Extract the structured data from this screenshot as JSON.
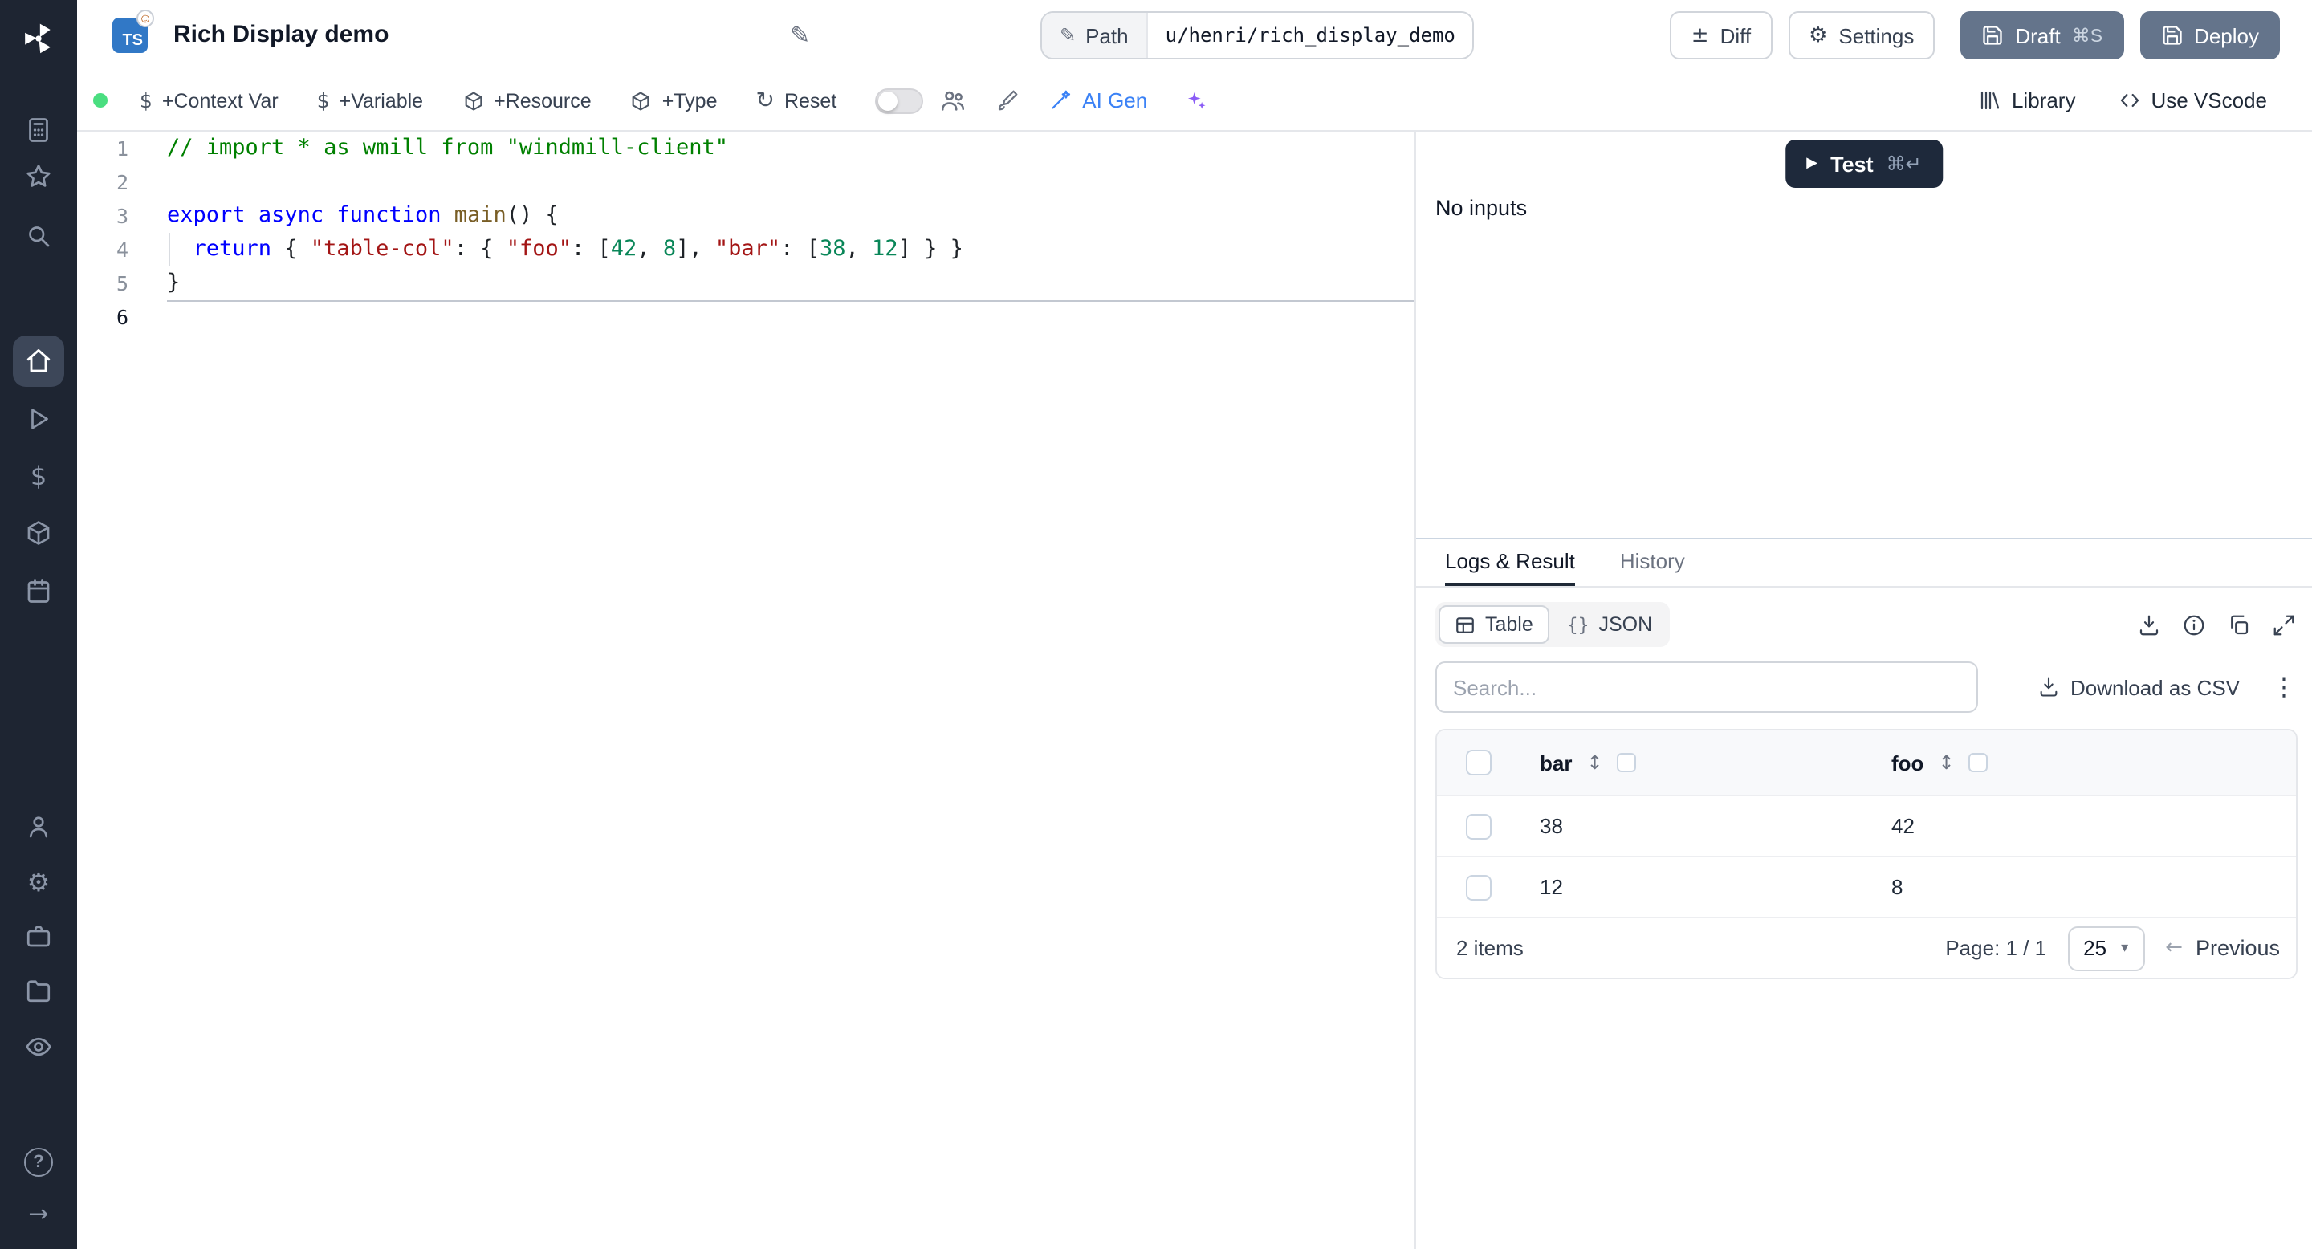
{
  "topbar": {
    "ts_badge": "TS",
    "sticker": "☺",
    "title": "Rich Display demo",
    "path_label": "Path",
    "path_value": "u/henri/rich_display_demo",
    "diff_label": "Diff",
    "settings_label": "Settings",
    "draft_label": "Draft",
    "draft_shortcut": "⌘S",
    "deploy_label": "Deploy"
  },
  "toolbar": {
    "context_var_label": "+Context Var",
    "variable_label": "+Variable",
    "resource_label": "+Resource",
    "type_label": "+Type",
    "reset_label": "Reset",
    "ai_gen_label": "AI Gen",
    "library_label": "Library",
    "vscode_label": "Use VScode"
  },
  "icons": {
    "pencil": "✎",
    "gear": "⚙",
    "reset": "↻",
    "diff": "±",
    "dollar": "$",
    "kebab": "⋮",
    "sort": "↕",
    "chevron_down": "▾",
    "arrow_left": "←",
    "arrow_right": "→",
    "play": "▶",
    "braces": "{}",
    "question": "?"
  },
  "editor": {
    "lines": [
      {
        "num": "1",
        "segments": [
          {
            "c": "comment",
            "t": "// import * as wmill from \"windmill-client\""
          }
        ]
      },
      {
        "num": "2",
        "segments": []
      },
      {
        "num": "3",
        "segments": [
          {
            "c": "keyword",
            "t": "export"
          },
          {
            "c": "plain",
            "t": " "
          },
          {
            "c": "keyword",
            "t": "async"
          },
          {
            "c": "plain",
            "t": " "
          },
          {
            "c": "keyword",
            "t": "function"
          },
          {
            "c": "plain",
            "t": " "
          },
          {
            "c": "func",
            "t": "main"
          },
          {
            "c": "plain",
            "t": "() {"
          }
        ]
      },
      {
        "num": "4",
        "guide": true,
        "segments": [
          {
            "c": "plain",
            "t": "  "
          },
          {
            "c": "keyword",
            "t": "return"
          },
          {
            "c": "plain",
            "t": " { "
          },
          {
            "c": "string",
            "t": "\"table-col\""
          },
          {
            "c": "plain",
            "t": ": { "
          },
          {
            "c": "string",
            "t": "\"foo\""
          },
          {
            "c": "plain",
            "t": ": ["
          },
          {
            "c": "number",
            "t": "42"
          },
          {
            "c": "plain",
            "t": ", "
          },
          {
            "c": "number",
            "t": "8"
          },
          {
            "c": "plain",
            "t": "], "
          },
          {
            "c": "string",
            "t": "\"bar\""
          },
          {
            "c": "plain",
            "t": ": ["
          },
          {
            "c": "number",
            "t": "38"
          },
          {
            "c": "plain",
            "t": ", "
          },
          {
            "c": "number",
            "t": "12"
          },
          {
            "c": "plain",
            "t": "] } }"
          }
        ]
      },
      {
        "num": "5",
        "segments": [
          {
            "c": "plain",
            "t": "}"
          }
        ]
      },
      {
        "num": "6",
        "current": true,
        "segments": []
      }
    ]
  },
  "preview": {
    "test_label": "Test",
    "test_shortcut": "⌘↵",
    "empty_text": "No inputs"
  },
  "result_panel": {
    "tabs": {
      "logs": "Logs & Result",
      "history": "History"
    },
    "view": {
      "table": "Table",
      "json": "JSON"
    },
    "search_placeholder": "Search...",
    "download_csv_label": "Download as CSV",
    "table": {
      "columns": [
        "bar",
        "foo"
      ],
      "rows": [
        [
          "38",
          "42"
        ],
        [
          "12",
          "8"
        ]
      ],
      "items_label": "2 items",
      "page_label": "Page: 1 / 1",
      "page_size": "25",
      "previous_label": "Previous"
    }
  }
}
